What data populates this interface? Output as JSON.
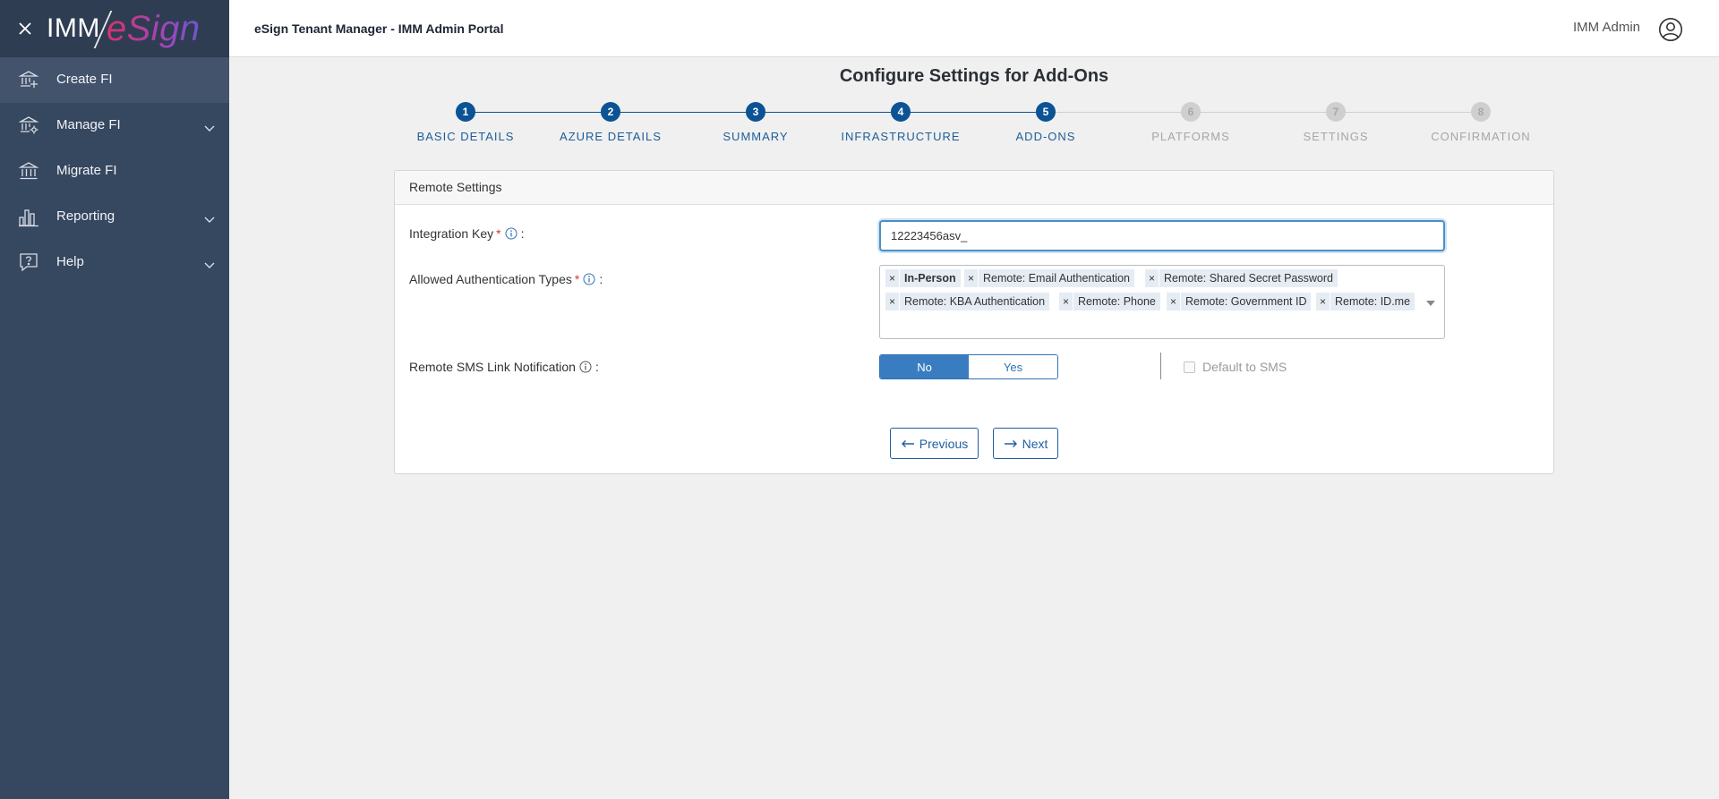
{
  "sidebar": {
    "logo": {
      "imm": "IMM",
      "esign": "eSign"
    },
    "items": [
      {
        "label": "Create FI",
        "icon": "bank-plus-icon",
        "active": true
      },
      {
        "label": "Manage FI",
        "icon": "bank-gear-icon",
        "has_children": true
      },
      {
        "label": "Migrate FI",
        "icon": "bank-icon"
      },
      {
        "label": "Reporting",
        "icon": "bar-chart-icon",
        "has_children": true
      },
      {
        "label": "Help",
        "icon": "help-chat-icon",
        "has_children": true
      }
    ]
  },
  "header": {
    "title": "eSign Tenant Manager - IMM Admin Portal",
    "user": "IMM Admin"
  },
  "page": {
    "title": "Configure Settings for Add-Ons"
  },
  "stepper": {
    "current_step": 5,
    "steps": [
      {
        "number": "1",
        "label": "BASIC DETAILS",
        "state": "complete"
      },
      {
        "number": "2",
        "label": "AZURE DETAILS",
        "state": "complete"
      },
      {
        "number": "3",
        "label": "SUMMARY",
        "state": "complete"
      },
      {
        "number": "4",
        "label": "INFRASTRUCTURE",
        "state": "complete"
      },
      {
        "number": "5",
        "label": "ADD-ONS",
        "state": "current"
      },
      {
        "number": "6",
        "label": "PLATFORMS",
        "state": "pending"
      },
      {
        "number": "7",
        "label": "SETTINGS",
        "state": "pending"
      },
      {
        "number": "8",
        "label": "CONFIRMATION",
        "state": "pending"
      }
    ]
  },
  "form": {
    "section_title": "Remote Settings",
    "integration_key": {
      "label": "Integration Key",
      "required_mark": "*",
      "value": "12223456asv_"
    },
    "auth_types": {
      "label": "Allowed Authentication Types",
      "required_mark": "*",
      "selected": [
        "In-Person",
        "Remote: Email Authentication",
        "Remote: Shared Secret Password",
        "Remote: KBA Authentication",
        "Remote: Phone",
        "Remote: Government ID",
        "Remote: ID.me"
      ],
      "remove_glyph": "×"
    },
    "sms_notification": {
      "label": "Remote SMS Link Notification",
      "options": [
        "No",
        "Yes"
      ],
      "selected": "No",
      "default_to_sms": {
        "label": "Default to SMS",
        "checked": false,
        "enabled": false
      }
    },
    "colon": ":"
  },
  "actions": {
    "previous": "Previous",
    "next": "Next"
  },
  "colors": {
    "sidebar": "#364760",
    "accent": "#0b5394",
    "inactive_step": "#cfcfcf",
    "toggle_on": "#3a7cc0"
  }
}
